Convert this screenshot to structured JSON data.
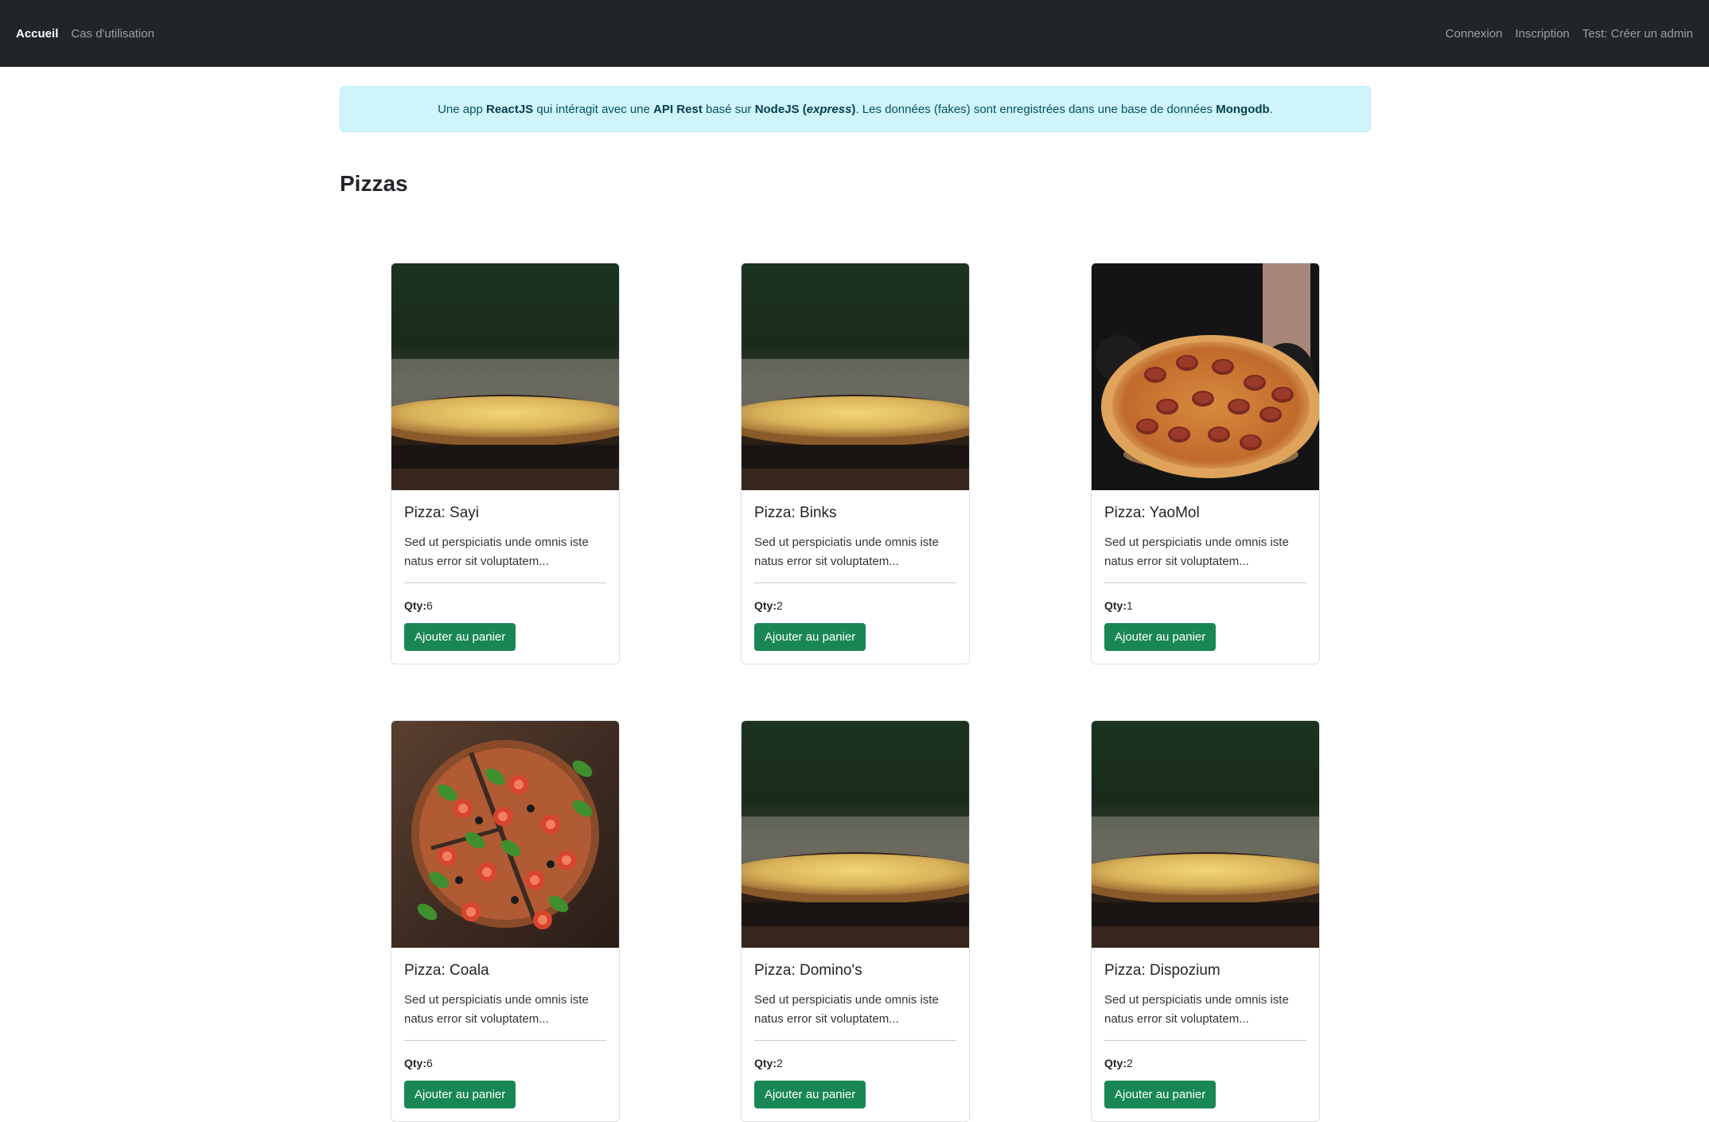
{
  "nav": {
    "home": "Accueil",
    "use_cases": "Cas d'utilisation",
    "login": "Connexion",
    "register": "Inscription",
    "test_admin": "Test: Créer un admin"
  },
  "alert": {
    "p1": "Une app ",
    "b1": "ReactJS",
    "p2": " qui intéragit avec une ",
    "b2": "API Rest",
    "p3": " basé sur ",
    "b3": "NodeJS (",
    "i3": "express",
    "b3end": ")",
    "p4": ". Les données (fakes) sont enregistrées dans une base de données ",
    "b4": "Mongodb",
    "p5": "."
  },
  "page_title": "Pizzas",
  "cards": [
    {
      "title": "Pizza: Sayi",
      "text": "Sed ut perspiciatis unde omnis iste natus error sit voluptatem...",
      "qty_label": "Qty:",
      "qty": "6",
      "button": "Ajouter au panier",
      "image": "cheese-pizza"
    },
    {
      "title": "Pizza: Binks",
      "text": "Sed ut perspiciatis unde omnis iste natus error sit voluptatem...",
      "qty_label": "Qty:",
      "qty": "2",
      "button": "Ajouter au panier",
      "image": "cheese-pizza"
    },
    {
      "title": "Pizza: YaoMol",
      "text": "Sed ut perspiciatis unde omnis iste natus error sit voluptatem...",
      "qty_label": "Qty:",
      "qty": "1",
      "button": "Ajouter au panier",
      "image": "pepperoni-pizza"
    },
    {
      "title": "Pizza: Coala",
      "text": "Sed ut perspiciatis unde omnis iste natus error sit voluptatem...",
      "qty_label": "Qty:",
      "qty": "6",
      "button": "Ajouter au panier",
      "image": "basil-tomato-pizza"
    },
    {
      "title": "Pizza: Domino's",
      "text": "Sed ut perspiciatis unde omnis iste natus error sit voluptatem...",
      "qty_label": "Qty:",
      "qty": "2",
      "button": "Ajouter au panier",
      "image": "cheese-pizza"
    },
    {
      "title": "Pizza: Dispozium",
      "text": "Sed ut perspiciatis unde omnis iste natus error sit voluptatem...",
      "qty_label": "Qty:",
      "qty": "2",
      "button": "Ajouter au panier",
      "image": "cheese-pizza"
    }
  ],
  "colors": {
    "navbar": "#212529",
    "alert_bg": "#cff4fc",
    "button": "#198754"
  }
}
